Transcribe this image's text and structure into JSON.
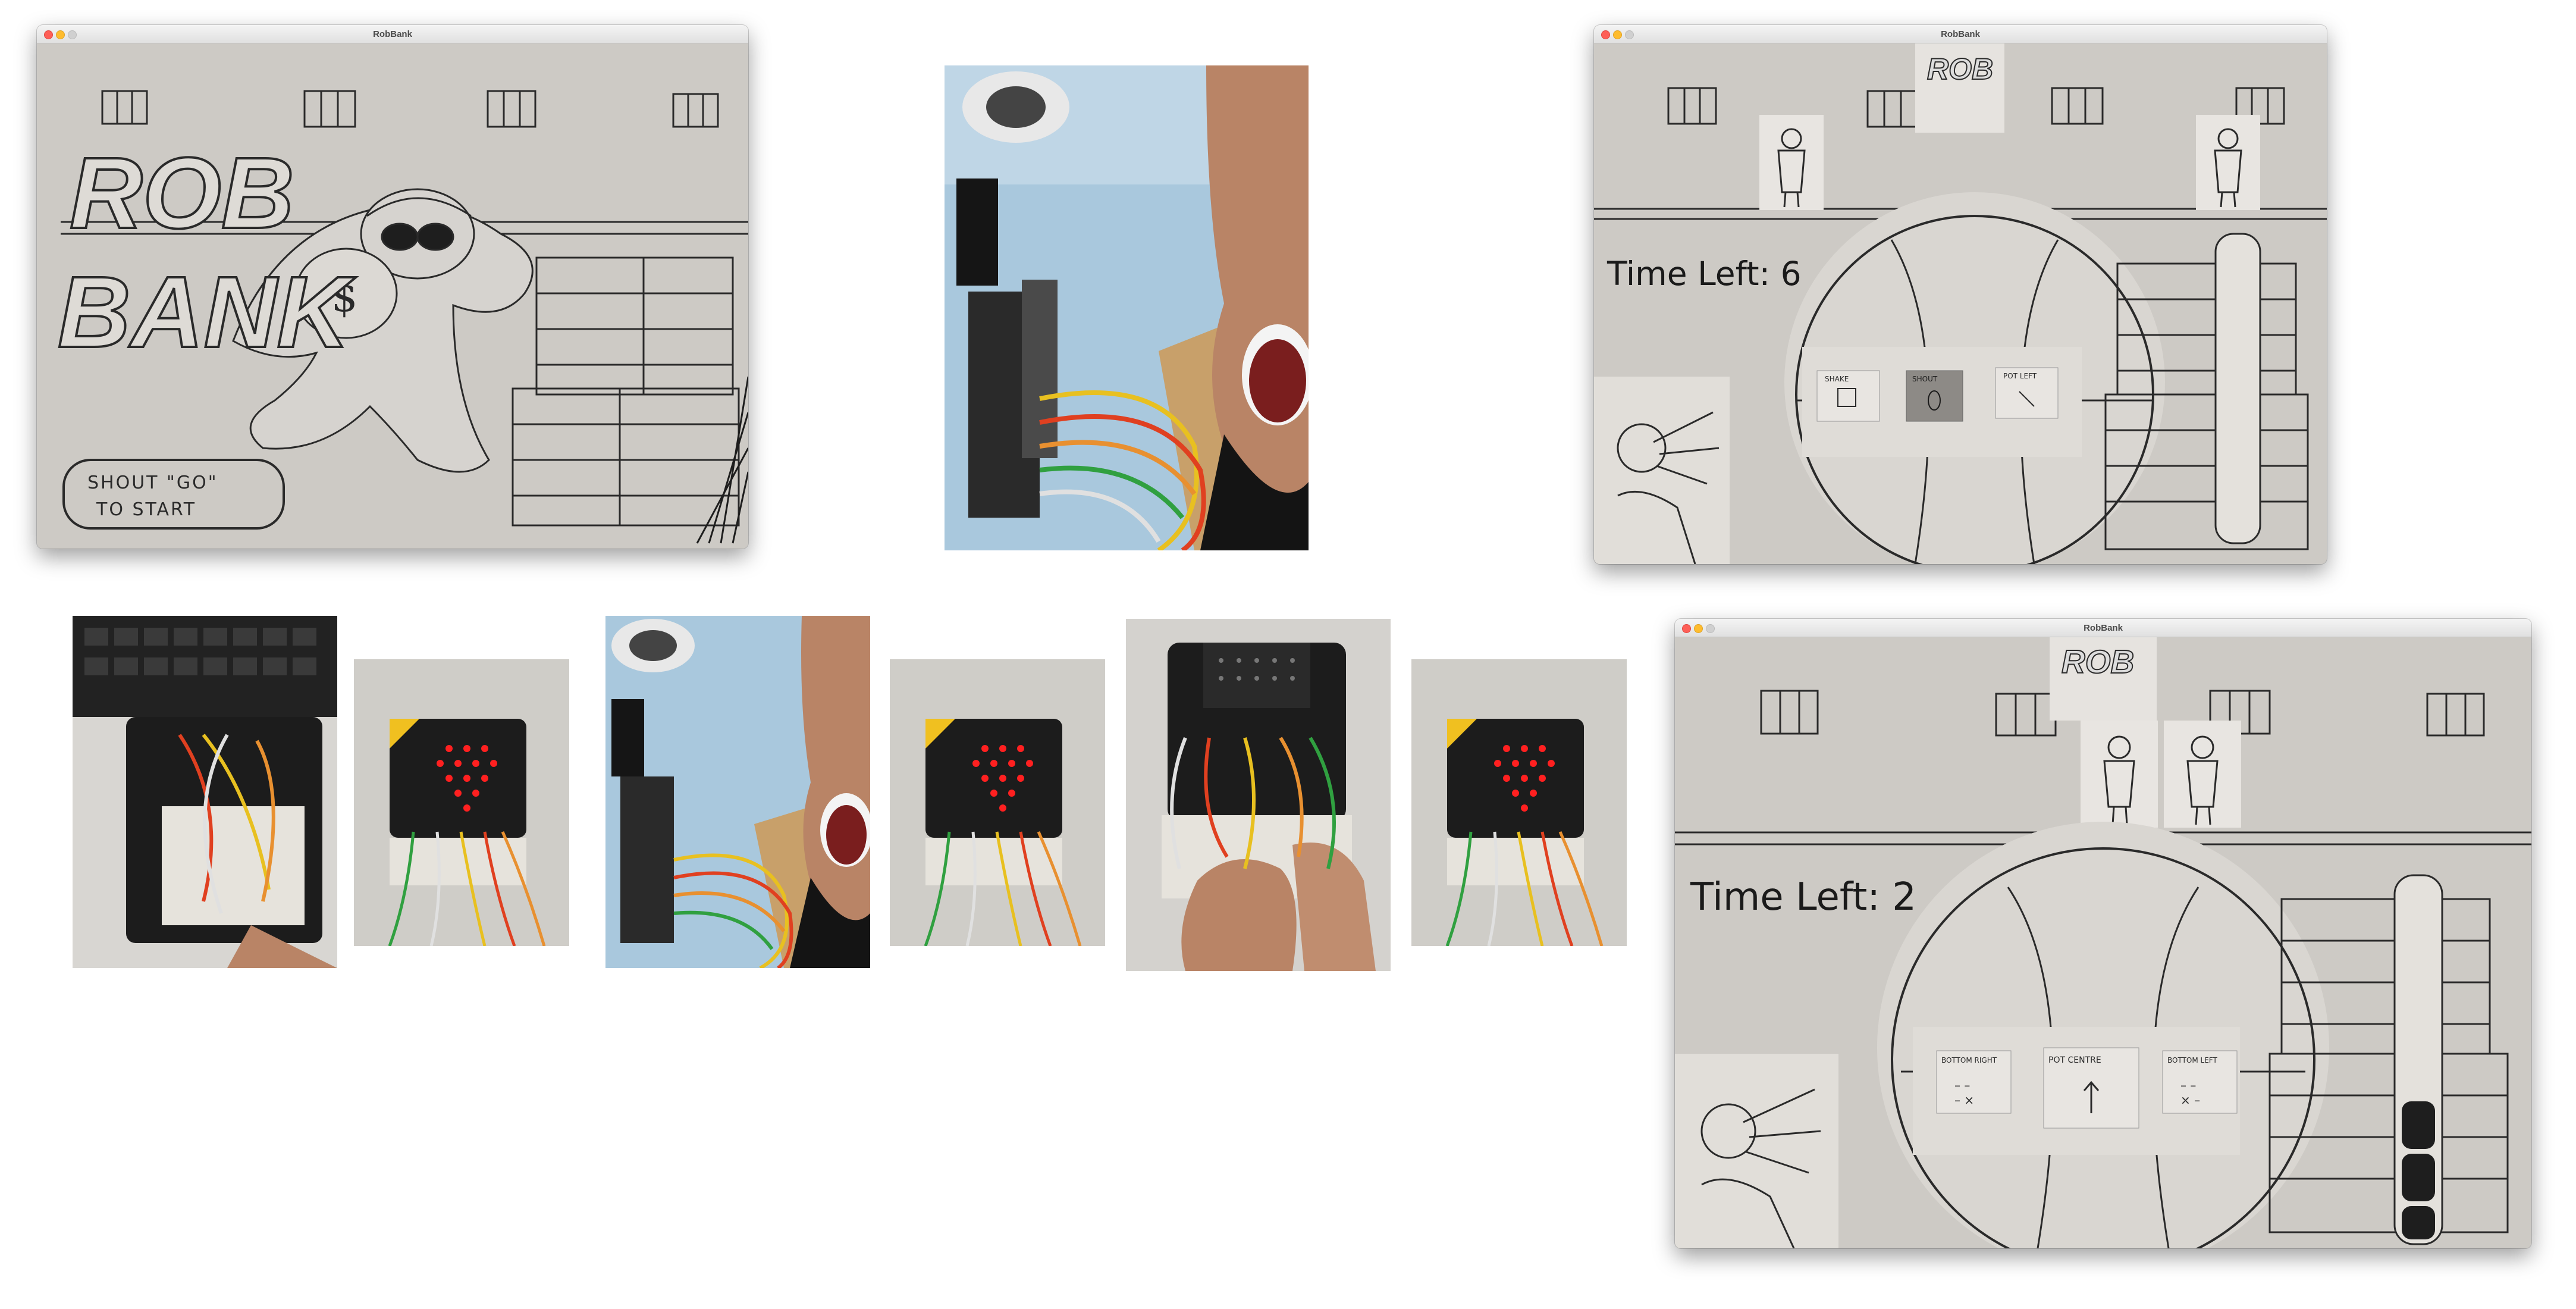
{
  "app_title": "RobBank",
  "windows": {
    "start": {
      "title": "RobBank",
      "logo_line1": "ROB",
      "logo_line2": "BANK",
      "prompt_line1": "SHOUT \"GO\"",
      "prompt_line2": "TO START"
    },
    "game1": {
      "title": "RobBank",
      "timer": "Time Left: 6",
      "cards": [
        "SHAKE",
        "SHOUT",
        "POT LEFT"
      ]
    },
    "game2": {
      "title": "RobBank",
      "timer": "Time Left: 2",
      "cards": [
        "BOTTOM RIGHT",
        "POT CENTRE",
        "BOTTOM LEFT"
      ]
    }
  },
  "photos": [
    "hand-held-breadboard",
    "microbit-heart-display",
    "shouting-at-device",
    "microbit-heart-display",
    "hands-adjusting-wires",
    "microbit-heart-display"
  ],
  "colors": {
    "paper": "#cdcac5",
    "ink": "#2a2a2a",
    "led": "#ff2020",
    "board": "#1c1c1c",
    "skin": "#b98466",
    "sky": "#a9c8dd"
  }
}
